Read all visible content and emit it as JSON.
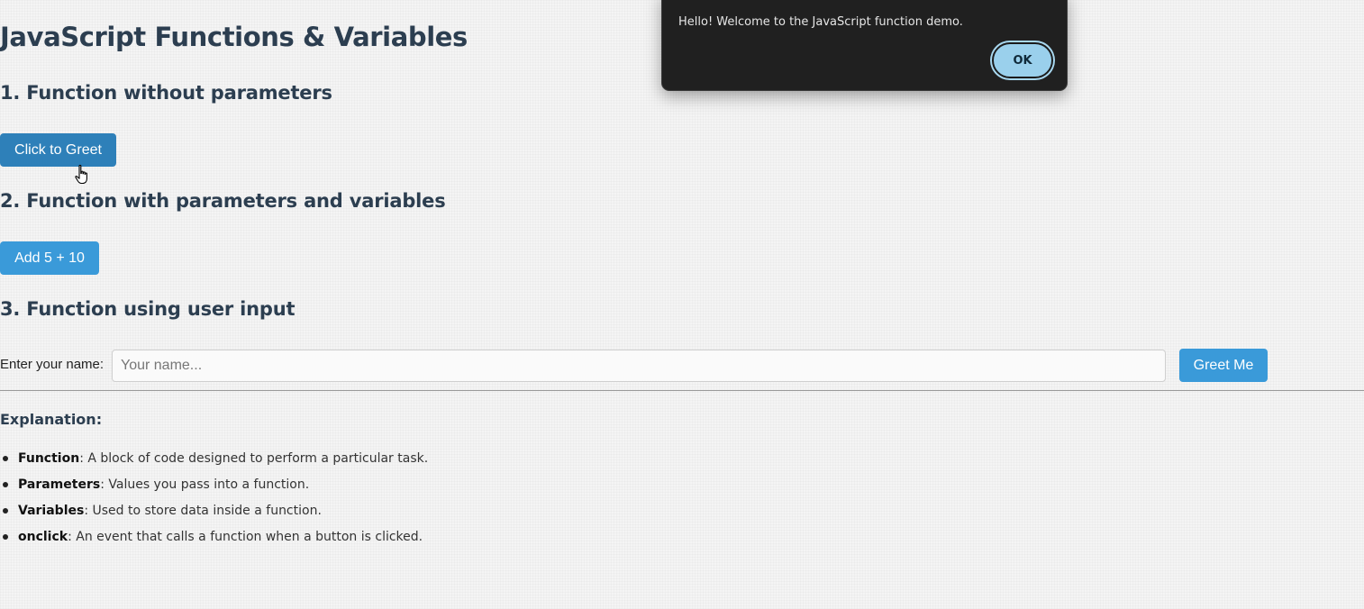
{
  "page": {
    "title": "JavaScript Functions & Variables"
  },
  "section1": {
    "heading": "1. Function without parameters",
    "button_label": "Click to Greet"
  },
  "section2": {
    "heading": "2. Function with parameters and variables",
    "button_label": "Add 5 + 10"
  },
  "section3": {
    "heading": "3. Function using user input",
    "input_label": "Enter your name:",
    "input_value": "",
    "input_placeholder": "Your name...",
    "button_label": "Greet Me"
  },
  "explanation": {
    "heading": "Explanation:",
    "items": [
      {
        "term": "Function",
        "text": ": A block of code designed to perform a particular task."
      },
      {
        "term": "Parameters",
        "text": ": Values you pass into a function."
      },
      {
        "term": "Variables",
        "text": ": Used to store data inside a function."
      },
      {
        "term": "onclick",
        "text": ": An event that calls a function when a button is clicked."
      }
    ]
  },
  "alert": {
    "message": "Hello! Welcome to the JavaScript function demo.",
    "ok_label": "OK"
  },
  "colors": {
    "accent": "#3a9ad9",
    "accent_hover": "#2e80b9",
    "heading": "#2c3e50",
    "dialog_bg": "#202020",
    "ok_button": "#9ad0ec"
  },
  "icons": {
    "cursor": "hand-pointer-icon",
    "bullet": "disc-bullet-icon"
  }
}
